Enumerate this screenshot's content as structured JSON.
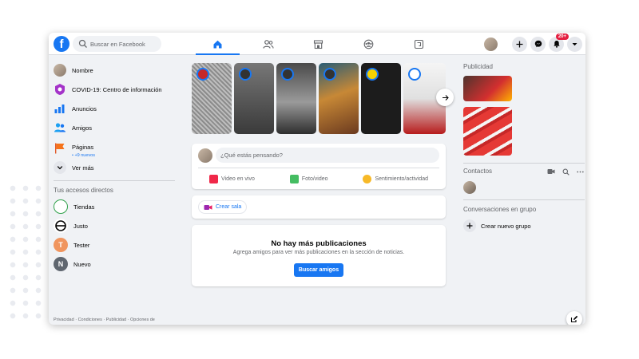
{
  "header": {
    "logo": "f",
    "search_placeholder": "Buscar en Facebook",
    "notification_count": "20+",
    "tabs": [
      {
        "icon": "home-icon",
        "active": true
      },
      {
        "icon": "friends-icon",
        "active": false
      },
      {
        "icon": "marketplace-icon",
        "active": false
      },
      {
        "icon": "groups-icon",
        "active": false
      },
      {
        "icon": "gaming-icon",
        "active": false
      }
    ]
  },
  "sidebar": {
    "items": [
      {
        "label": "Nombre",
        "icon": "user-avatar"
      },
      {
        "label": "COVID-19: Centro de información",
        "icon": "covid-icon"
      },
      {
        "label": "Anuncios",
        "icon": "ads-icon"
      },
      {
        "label": "Amigos",
        "icon": "friends-icon"
      },
      {
        "label": "Páginas",
        "sub": "• +9 nuevos",
        "icon": "pages-flag-icon"
      },
      {
        "label": "Ver más",
        "icon": "chevron-down-icon"
      }
    ],
    "shortcuts_title": "Tus accesos directos",
    "shortcuts": [
      {
        "label": "Tiendas",
        "letter": ""
      },
      {
        "label": "Justo",
        "letter": ""
      },
      {
        "label": "Tester",
        "letter": "T"
      },
      {
        "label": "Nuevo",
        "letter": "N"
      }
    ],
    "footer": "Privacidad · Condiciones · Publicidad · Opciones de"
  },
  "composer": {
    "placeholder": "¿Qué estás pensando?",
    "actions": [
      "Video en vivo",
      "Foto/video",
      "Sentimiento/actividad"
    ]
  },
  "room": {
    "label": "Crear sala"
  },
  "empty_feed": {
    "title": "No hay más publicaciones",
    "subtitle": "Agrega amigos para ver más publicaciones en la sección de noticias.",
    "button": "Buscar amigos"
  },
  "right": {
    "ads_title": "Publicidad",
    "contacts_title": "Contactos",
    "groups_title": "Conversaciones en grupo",
    "create_group": "Crear nuevo grupo"
  },
  "colors": {
    "brand": "#1877f2",
    "badge": "#e41e3f"
  }
}
